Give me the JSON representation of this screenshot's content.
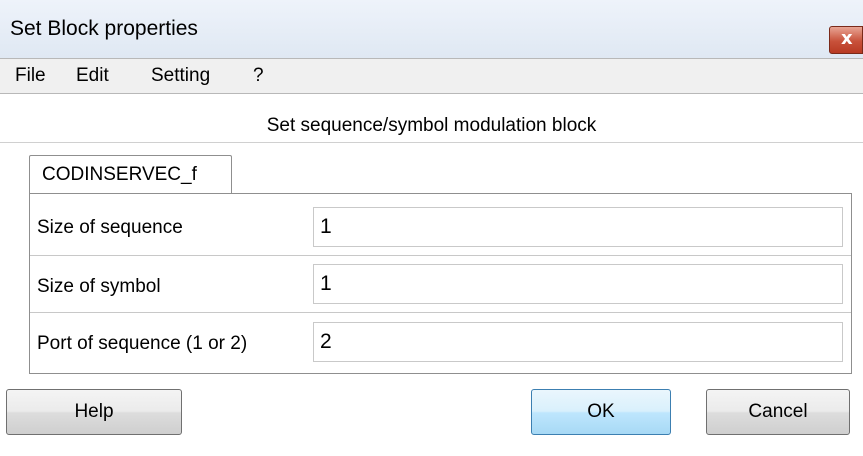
{
  "window": {
    "title": "Set Block properties",
    "close_icon": "close-icon"
  },
  "menubar": {
    "items": [
      "File",
      "Edit",
      "Setting",
      "?"
    ]
  },
  "dialog": {
    "heading": "Set sequence/symbol modulation block",
    "tab_label": "CODINSERVEC_f",
    "fields": [
      {
        "label": "Size of sequence",
        "value": "1"
      },
      {
        "label": "Size of symbol",
        "value": "1"
      },
      {
        "label": "Port of sequence (1 or 2)",
        "value": "2"
      }
    ]
  },
  "buttons": {
    "help": "Help",
    "ok": "OK",
    "cancel": "Cancel"
  },
  "colors": {
    "title_bar": "#dfe8f3",
    "close_button": "#c8513a",
    "default_button": "#bee6fd"
  }
}
